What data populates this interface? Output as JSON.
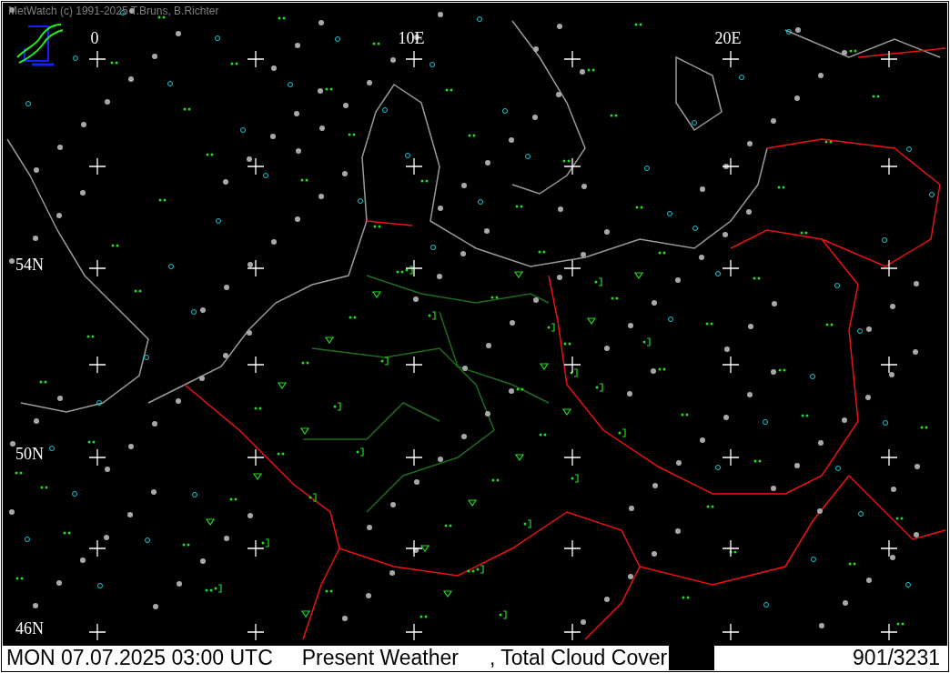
{
  "app": {
    "copyright": "MetWatch  (c) 1991-2025 T.Bruns, B.Richter"
  },
  "map": {
    "lon_labels": [
      "0",
      "10E",
      "20E"
    ],
    "lat_labels": [
      "54N",
      "50N",
      "46N"
    ]
  },
  "status_bar": {
    "datetime": "MON 07.07.2025 03:00 UTC",
    "parameter": "Present Weather",
    "overlay": ", Total Cloud Cover",
    "count": "901/3231"
  }
}
